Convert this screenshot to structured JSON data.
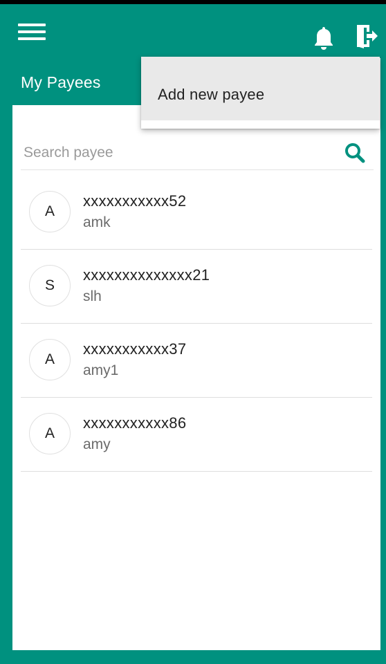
{
  "app_bar": {
    "menu_icon": "hamburger-menu-icon",
    "notification_icon": "bell-icon",
    "logout_icon": "logout-door-icon"
  },
  "tab": {
    "title": "My Payees"
  },
  "popup_menu": {
    "items": [
      {
        "label": "Add new payee"
      }
    ]
  },
  "search": {
    "placeholder": "Search payee",
    "value": "",
    "icon": "search-icon"
  },
  "payees": [
    {
      "initial": "A",
      "account": "xxxxxxxxxxx52",
      "nickname": "amk"
    },
    {
      "initial": "S",
      "account": "xxxxxxxxxxxxxx21",
      "nickname": "slh"
    },
    {
      "initial": "A",
      "account": "xxxxxxxxxxx37",
      "nickname": "amy1"
    },
    {
      "initial": "A",
      "account": "xxxxxxxxxxx86",
      "nickname": "amy"
    }
  ],
  "colors": {
    "primary": "#00917f",
    "background": "#ffffff",
    "popup_highlight": "#e9e9e9"
  }
}
